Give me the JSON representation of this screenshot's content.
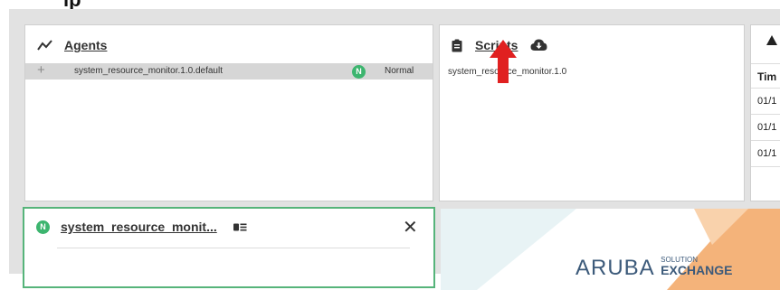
{
  "agents_panel": {
    "title": "Agents",
    "rows": [
      {
        "name": "system_resource_monitor.1.0.default",
        "badge": "N",
        "status": "Normal"
      }
    ]
  },
  "scripts_panel": {
    "title": "Scripts",
    "items": [
      "system_resource_monitor.1.0"
    ]
  },
  "history_panel": {
    "header": "Tim",
    "rows": [
      "01/1",
      "01/1",
      "01/1"
    ]
  },
  "detail_panel": {
    "badge": "N",
    "title": "system_resource_monit..."
  },
  "brand": {
    "text": "ARUBA",
    "superscript": "SOLUTION",
    "subtext": "EXCHANGE"
  },
  "colors": {
    "normal_badge": "#3db56f",
    "annotation_arrow": "#e02020",
    "panel_background": "#e2e2e2",
    "brand_accent": "#f4b37a"
  }
}
